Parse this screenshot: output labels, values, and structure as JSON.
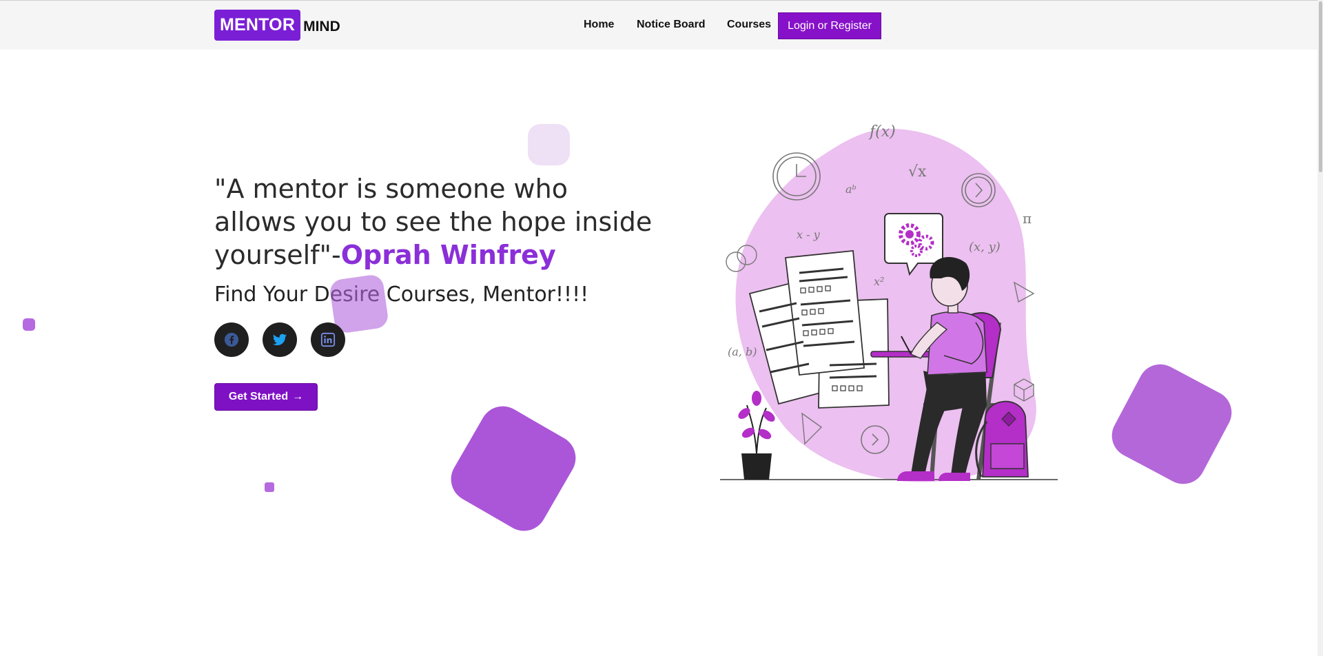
{
  "navbar": {
    "logo_box": "MENTOR",
    "logo_text": "MIND",
    "links": [
      "Home",
      "Notice Board",
      "Courses"
    ],
    "login_label": "Login or Register"
  },
  "hero": {
    "quote_text": "\"A mentor is someone who allows you to see the hope inside yourself\"-",
    "quote_author": "Oprah Winfrey",
    "subtitle": "Find Your Desire Courses, Mentor!!!!",
    "socials": [
      "facebook-icon",
      "twitter-icon",
      "linkedin-icon"
    ],
    "cta_label": "Get Started"
  },
  "illustration": {
    "math_symbols": [
      "f(x)",
      "√x",
      "aᵇ",
      "x - y",
      "x²",
      "(x, y)",
      "π",
      "(a, b)"
    ]
  },
  "colors": {
    "brand": "#7b1fd6",
    "accent": "#8b2fd8",
    "decor": "#ab56d9",
    "blob": "#ecc0f0"
  }
}
